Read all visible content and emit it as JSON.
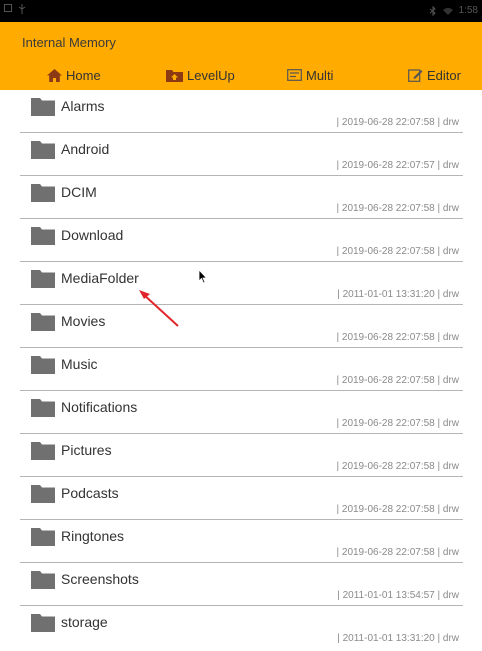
{
  "app": {
    "title": "Internal Memory",
    "accent_color": "#ffab00"
  },
  "status_bar": {
    "time": "1:58"
  },
  "toolbar": {
    "home_label": "Home",
    "levelup_label": "LevelUp",
    "multi_label": "Multi",
    "editor_label": "Editor"
  },
  "files": [
    {
      "name": "Alarms",
      "meta": "| 2019-06-28 22:07:58 | drw"
    },
    {
      "name": "Android",
      "meta": "| 2019-06-28 22:07:57 | drw"
    },
    {
      "name": "DCIM",
      "meta": "| 2019-06-28 22:07:58 | drw"
    },
    {
      "name": "Download",
      "meta": "| 2019-06-28 22:07:58 | drw"
    },
    {
      "name": "MediaFolder",
      "meta": "| 2011-01-01 13:31:20 | drw"
    },
    {
      "name": "Movies",
      "meta": "| 2019-06-28 22:07:58 | drw"
    },
    {
      "name": "Music",
      "meta": "| 2019-06-28 22:07:58 | drw"
    },
    {
      "name": "Notifications",
      "meta": "| 2019-06-28 22:07:58 | drw"
    },
    {
      "name": "Pictures",
      "meta": "| 2019-06-28 22:07:58 | drw"
    },
    {
      "name": "Podcasts",
      "meta": "| 2019-06-28 22:07:58 | drw"
    },
    {
      "name": "Ringtones",
      "meta": "| 2019-06-28 22:07:58 | drw"
    },
    {
      "name": "Screenshots",
      "meta": "| 2011-01-01 13:54:57 | drw"
    },
    {
      "name": "storage",
      "meta": "| 2011-01-01 13:31:20 | drw"
    }
  ]
}
